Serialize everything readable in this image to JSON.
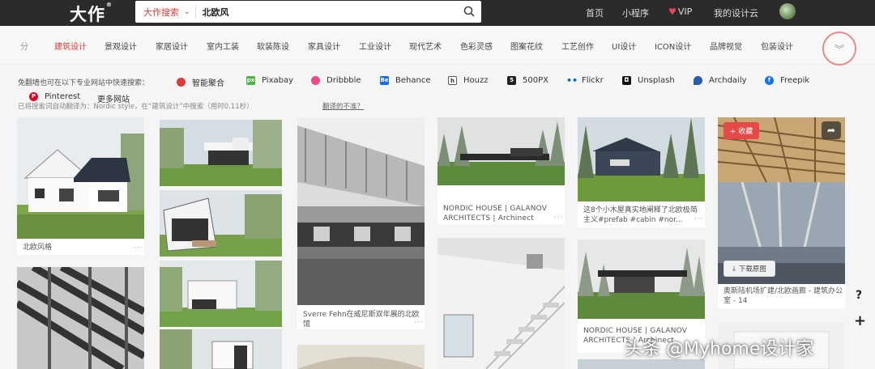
{
  "topbar": {
    "logo": "大作",
    "logo_mark": "®",
    "search_type": "大作搜索",
    "search_value": "北欧风",
    "nav": [
      "首页",
      "小程序",
      "VIP",
      "我的设计云"
    ]
  },
  "categories": {
    "prefix": "分",
    "items": [
      "建筑设计",
      "景观设计",
      "家居设计",
      "室内工装",
      "软装陈设",
      "家具设计",
      "工业设计",
      "现代艺术",
      "色彩灵感",
      "图案花纹",
      "工艺创作",
      "UI设计",
      "ICON设计",
      "品牌视觉",
      "包装设计"
    ],
    "active": "建筑设计"
  },
  "quick_search": {
    "label": "免翻墙也可在以下专业网站中快速搜索：",
    "sites": [
      "智能聚合",
      "Pixabay",
      "Dribbble",
      "Behance",
      "Houzz",
      "500PX",
      "Flickr",
      "Unsplash",
      "Archdaily",
      "Freepik",
      "Pinterest",
      "更多网站"
    ],
    "notice": "已将搜索词自动翻译为：Nordic style，在“建筑设计”中搜索（用时0.11秒）",
    "notice_link": "翻译的不准？"
  },
  "results": {
    "c1_caption": "北欧风格",
    "c3_caption": "Sverre Fehn在威尼斯双年展的北欧馆",
    "c4_caption": "NORDIC HOUSE | GALANOV ARCHITECTS | Archinect",
    "c5_caption": "这8个小木屋真实地阐释了北欧极简主义#prefab #cabin #nor...",
    "c5b_caption": "NORDIC HOUSE | GALANOV ARCHITECTS | Archinect",
    "c6_caption": "奥斯陆机场扩建/北欧画廊 - 建筑办公室 - 14",
    "more": "···",
    "fav_label": "+ 收藏",
    "download_label": "下载原图"
  },
  "side": {
    "help": "?",
    "add": "+"
  },
  "watermark": "头条 @Myhome设计家",
  "colors": {
    "accent": "#d93a3a",
    "topbar": "#2b2b2b"
  }
}
